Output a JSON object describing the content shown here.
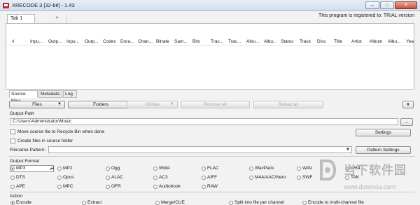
{
  "window": {
    "title": "XRECODE 3 [32-bit] - 1.43"
  },
  "tabs": {
    "active": "Tab 1",
    "add": "+"
  },
  "registration": "This program is registered to: TRIAL version",
  "columns": [
    "#",
    "Inpu...",
    "Outp...",
    "Inpu...",
    "Outp...",
    "Codec",
    "Dura...",
    "Chan...",
    "Bitrate",
    "Sam...",
    "Bits",
    "Trac...",
    "Trac...",
    "Albu...",
    "Albu...",
    "Status",
    "Track",
    "Disc",
    "Title",
    "Artist",
    "Album",
    "Albu...",
    "Yea"
  ],
  "bottom_tabs": [
    "Source Files",
    "Metadata",
    "Log"
  ],
  "toolbar": {
    "files": "Files",
    "folders": "Folders",
    "utilities": "Utilities",
    "remove_all": "Remove all",
    "reload_all": "Reload all"
  },
  "output_path": {
    "label": "Output Path",
    "value": "C:\\Users\\Administrator\\Music",
    "browse": "..."
  },
  "options": {
    "recycle": "Move source file to Recycle Bin when done",
    "create_in_source": "Create files in source folder",
    "settings": "Settings",
    "filename_pattern": "Filename Pattern:",
    "pattern_settings": "Pattern Settings"
  },
  "output_format": {
    "label": "Output Format",
    "formats": [
      "MP3",
      "MP2",
      "Ogg",
      "WMA",
      "FLAC",
      "WavPack",
      "WAV",
      "W64",
      "DTS",
      "Opus",
      "ALAC",
      "AC3",
      "AIFF",
      "M4A/AAC/Nero",
      "SWF",
      "TAK",
      "APE",
      "MPC",
      "OFR",
      "Audiobook",
      "RAW"
    ],
    "selected": "MP3"
  },
  "action": {
    "label": "Action",
    "items": [
      "Encode",
      "Extract",
      "Merge/CUE",
      "Split into file per channel",
      "Encode to multi-channel file"
    ],
    "selected": "Encode"
  },
  "watermark": {
    "logo_icon": "d-logo-icon",
    "text": "当下软件园",
    "url": "www.downxia.com"
  }
}
